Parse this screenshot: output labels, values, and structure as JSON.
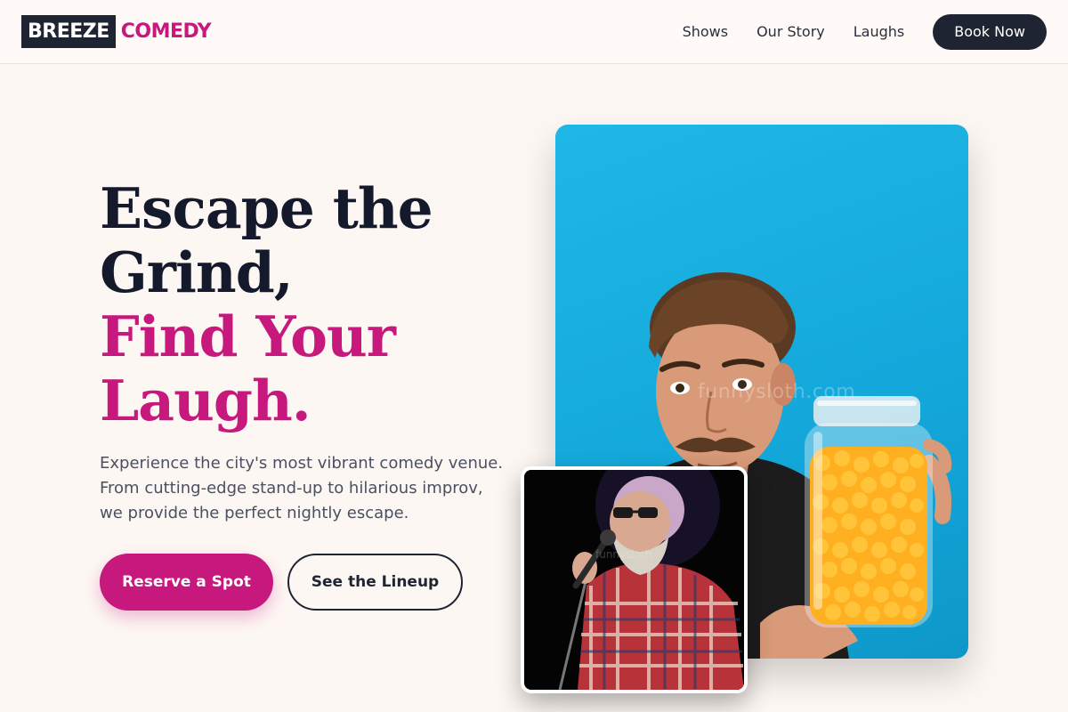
{
  "header": {
    "logo_primary": "BREEZE",
    "logo_accent": "COMEDY",
    "nav": [
      {
        "label": "Shows"
      },
      {
        "label": "Our Story"
      },
      {
        "label": "Laughs"
      }
    ],
    "cta_label": "Book Now"
  },
  "hero": {
    "title_line1": "Escape the",
    "title_line2": "Grind,",
    "title_line3": "Find Your",
    "title_line4": "Laugh.",
    "description": "Experience the city's most vibrant comedy venue. From cutting-edge stand-up to hilarious improv, we provide the perfect nightly escape.",
    "primary_button": "Reserve a Spot",
    "secondary_button": "See the Lineup"
  },
  "images": {
    "main_watermark": "funnysloth.com",
    "small_watermark": "funnysloth"
  },
  "colors": {
    "brand_dark": "#1f2433",
    "brand_accent": "#c7187d",
    "page_background": "#fdf7f3",
    "photo_background": "#14a8db"
  }
}
